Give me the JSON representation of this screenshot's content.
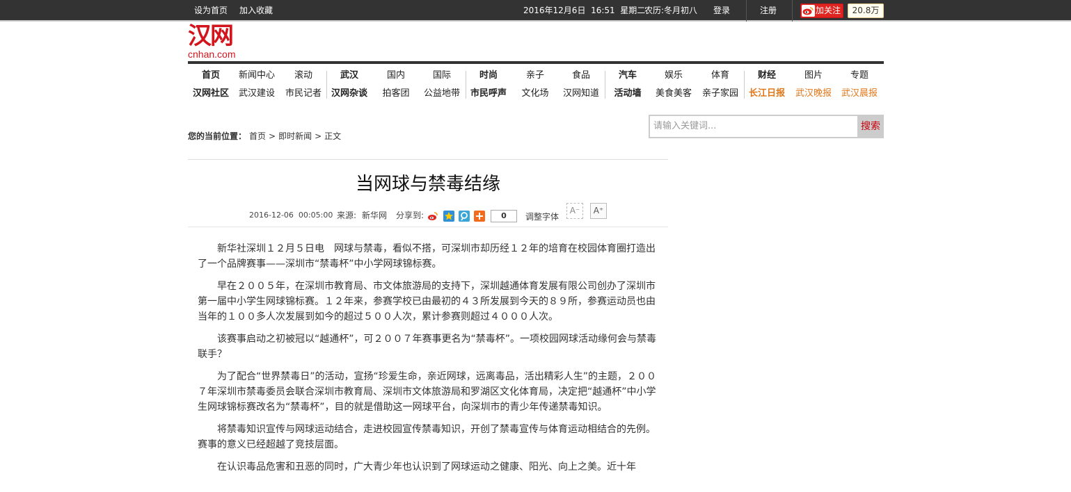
{
  "topbar": {
    "set_home": "设为首页",
    "add_fav": "加入收藏",
    "datetime": "2016年12月6日  16:51  星期二",
    "lunar": "农历:冬月初八",
    "login": "登录",
    "register": "注册",
    "follow": "加关注",
    "follower_count": "20.8万"
  },
  "logo": {
    "cn": "汉网",
    "en": "cnhan.com"
  },
  "nav": {
    "row1": [
      "首页",
      "新闻中心",
      "滚动",
      "武汉",
      "国内",
      "国际",
      "时尚",
      "亲子",
      "食品",
      "汽车",
      "娱乐",
      "体育",
      "财经",
      "图片",
      "专题"
    ],
    "row2": [
      "汉网社区",
      "武汉建设",
      "市民记者",
      "汉网杂谈",
      "拍客团",
      "公益地带",
      "市民呼声",
      "文化场",
      "汉网知道",
      "活动墙",
      "美食美客",
      "亲子家园",
      "长江日报",
      "武汉晚报",
      "武汉晨报"
    ]
  },
  "breadcrumb": {
    "label": "您的当前位置：",
    "items": [
      "首页",
      "即时新闻",
      "正文"
    ],
    "sep": ">"
  },
  "search": {
    "placeholder": "请输入关键词...",
    "button": "搜索"
  },
  "article": {
    "title": "当网球与禁毒结缘",
    "date": "2016-12-06  00:05:00",
    "source_label": "来源:",
    "source": "新华网",
    "share_label": "分享到:",
    "share_count": "0",
    "font_adjust": "调整字体",
    "font_minus": "A⁻",
    "font_plus": "A⁺",
    "paragraphs": [
      "新华社深圳１２月５日电　网球与禁毒，看似不搭，可深圳市却历经１２年的培育在校园体育圈打造出了一个品牌赛事——深圳市“禁毒杯”中小学网球锦标赛。",
      "早在２００５年，在深圳市教育局、市文体旅游局的支持下，深圳越通体育发展有限公司创办了深圳市第一届中小学生网球锦标赛。１２年来，参赛学校已由最初的４３所发展到今天的８９所，参赛运动员也由当年的１００多人次发展到如今的超过５００人次，累计参赛则超过４０００人次。",
      "该赛事启动之初被冠以“越通杯”，可２００７年赛事更名为“禁毒杯”。一项校园网球活动缘何会与禁毒联手？",
      "为了配合“世界禁毒日”的活动，宣扬“珍爱生命，亲近网球，远离毒品，活出精彩人生”的主题，２００７年深圳市禁毒委员会联合深圳市教育局、深圳市文体旅游局和罗湖区文化体育局，决定把“越通杯”中小学生网球锦标赛改名为“禁毒杯”，目的就是借助这一网球平台，向深圳市的青少年传递禁毒知识。",
      "将禁毒知识宣传与网球运动结合，走进校园宣传禁毒知识，开创了禁毒宣传与体育运动相结合的先例。赛事的意义已经超越了竞技层面。",
      "在认识毒品危害和丑恶的同时，广大青少年也认识到了网球运动之健康、阳光、向上之美。近十年"
    ]
  },
  "colors": {
    "brand_red": "#d2141c",
    "topbar_bg": "#333333",
    "nav_orange": "#e0781a"
  },
  "icons": [
    "weibo-icon",
    "sina-weibo-share-icon",
    "qzone-share-icon",
    "tencent-weibo-share-icon",
    "more-share-icon"
  ]
}
